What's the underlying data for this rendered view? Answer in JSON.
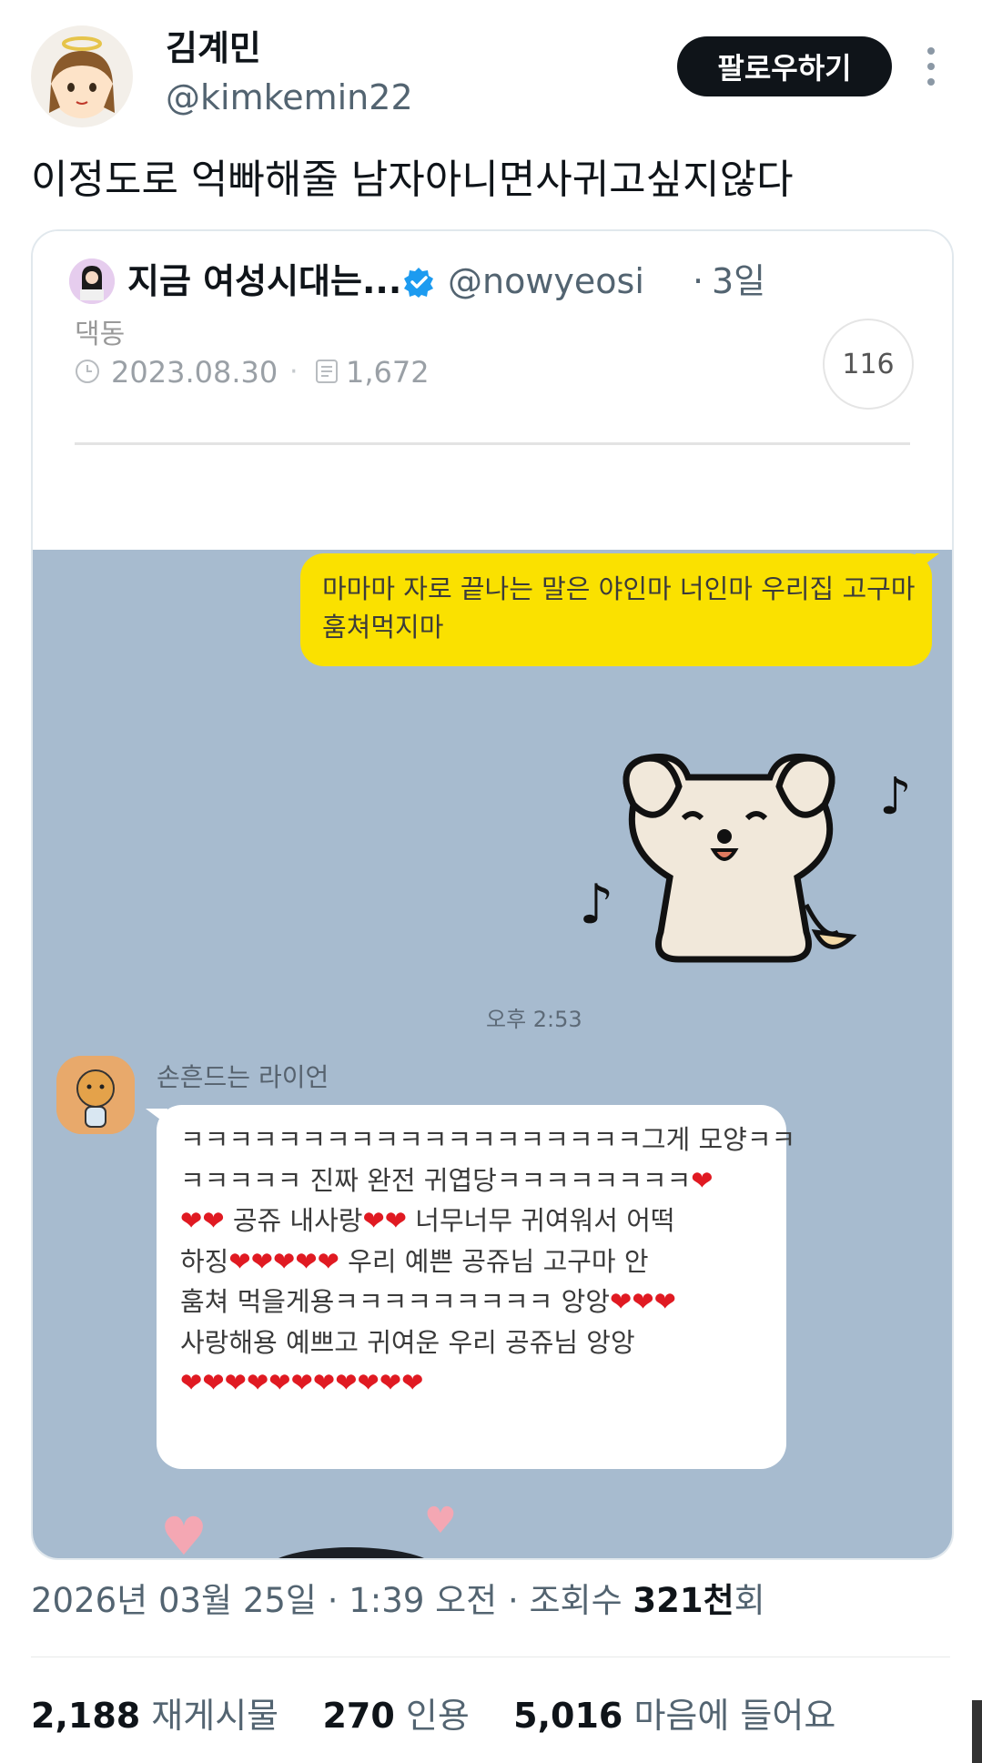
{
  "tweet": {
    "author": {
      "display_name": "김계민",
      "handle": "@kimkemin22",
      "avatar": "avatar-angel-girl-icon"
    },
    "follow_label": "팔로우하기",
    "more_icon": "more-vertical-icon",
    "text": "이정도로 억빠해줄 남자아니면사귀고싶지않다"
  },
  "quote": {
    "display_name": "지금 여성시대는...",
    "handle": "@nowyeosi",
    "separator": "·",
    "time": "3일",
    "verified_icon": "verified-badge-icon",
    "blog": {
      "cut_text": "댁동",
      "date": "2023.08.30",
      "separator": "·",
      "views": "1,672",
      "comment_count": "116"
    },
    "chat": {
      "my_message": "마마마 자로 끝나는 말은 야인마 너인마 우리집 고구마 훔쳐먹지마",
      "time": "오후 2:53",
      "sender_name": "손흔드는 라이언",
      "reply_lines": [
        "ㅋㅋㅋㅋㅋㅋㅋㅋㅋㅋㅋㅋㅋㅋㅋㅋㅋㅋㅋ그게 모양ㅋㅋ",
        "ㅋㅋㅋㅋㅋ 진짜 완전 귀엽당ㅋㅋㅋㅋㅋㅋㅋㅋ❤",
        "❤❤ 공쥬 내사랑❤❤ 너무너무 귀여워서 어떡",
        "하징❤❤❤❤❤ 우리 예쁜 공쥬님 고구마 안",
        "훔쳐 먹을게용ㅋㅋㅋㅋㅋㅋㅋㅋㅋ 앙앙❤❤❤",
        "사랑해용 예쁘고 귀여운 우리 공쥬님 앙앙",
        "❤❤❤❤❤❤❤❤❤❤❤"
      ]
    }
  },
  "meta": {
    "date": "2026년 03월 25일",
    "time": "1:39 오전",
    "views_label": "조회수",
    "views_value": "321천",
    "views_suffix": "회"
  },
  "stats": {
    "retweets": "2,188",
    "retweets_label": "재게시물",
    "quotes": "270",
    "quotes_label": "인용",
    "likes": "5,016",
    "likes_label": "마음에 들어요"
  },
  "colors": {
    "follow_bg": "#0f1419",
    "chat_bg": "#a7bbcf",
    "kakao_yellow": "#fae100",
    "verified": "#1d9bf0"
  }
}
